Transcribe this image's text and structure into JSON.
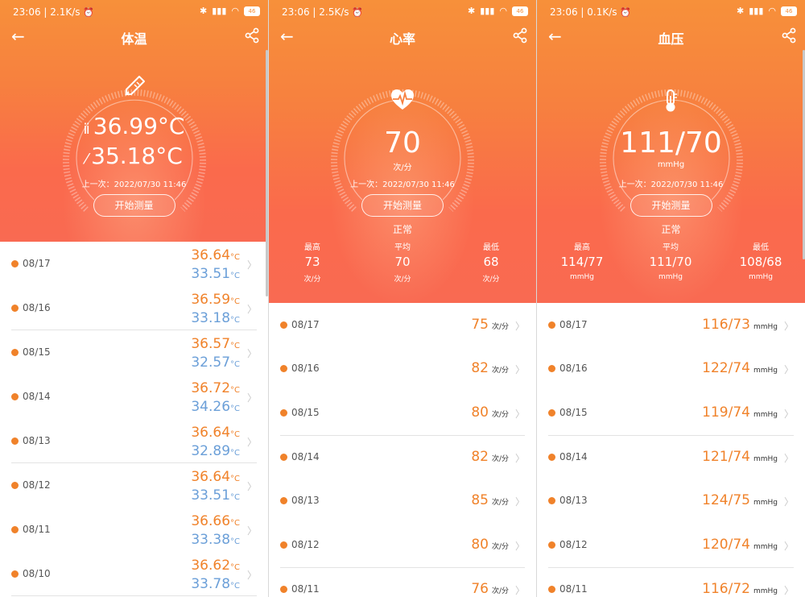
{
  "status_bars": [
    {
      "time": "23:06",
      "net": "2.1K/s",
      "battery": "46"
    },
    {
      "time": "23:06",
      "net": "2.5K/s",
      "battery": "46"
    },
    {
      "time": "23:06",
      "net": "0.1K/s",
      "battery": "46"
    }
  ],
  "temperature": {
    "title": "体温",
    "reading1": "36.99°C",
    "reading2": "35.18°C",
    "last_time": "上一次：2022/07/30 11:46",
    "measure_button": "开始测量",
    "unit": "°C",
    "rows": [
      {
        "date": "08/17",
        "v1": "36.64",
        "v2": "33.51"
      },
      {
        "date": "08/16",
        "v1": "36.59",
        "v2": "33.18"
      },
      {
        "date": "08/15",
        "v1": "36.57",
        "v2": "32.57"
      },
      {
        "date": "08/14",
        "v1": "36.72",
        "v2": "34.26"
      },
      {
        "date": "08/13",
        "v1": "36.64",
        "v2": "32.89"
      },
      {
        "date": "08/12",
        "v1": "36.64",
        "v2": "33.51"
      },
      {
        "date": "08/11",
        "v1": "36.66",
        "v2": "33.38"
      },
      {
        "date": "08/10",
        "v1": "36.62",
        "v2": "33.78"
      }
    ]
  },
  "heart_rate": {
    "title": "心率",
    "value": "70",
    "unit": "次/分",
    "last_time": "上一次：2022/07/30 11:46",
    "measure_button": "开始测量",
    "status": "正常",
    "stats": [
      {
        "label": "最高",
        "value": "73",
        "unit": "次/分"
      },
      {
        "label": "平均",
        "value": "70",
        "unit": "次/分"
      },
      {
        "label": "最低",
        "value": "68",
        "unit": "次/分"
      }
    ],
    "rows": [
      {
        "date": "08/17",
        "value": "75"
      },
      {
        "date": "08/16",
        "value": "82"
      },
      {
        "date": "08/15",
        "value": "80"
      },
      {
        "date": "08/14",
        "value": "82"
      },
      {
        "date": "08/13",
        "value": "85"
      },
      {
        "date": "08/12",
        "value": "80"
      },
      {
        "date": "08/11",
        "value": "76"
      }
    ]
  },
  "blood_pressure": {
    "title": "血压",
    "value": "111/70",
    "unit": "mmHg",
    "last_time": "上一次：2022/07/30 11:46",
    "measure_button": "开始测量",
    "status": "正常",
    "stats": [
      {
        "label": "最高",
        "value": "114/77",
        "unit": "mmHg"
      },
      {
        "label": "平均",
        "value": "111/70",
        "unit": "mmHg"
      },
      {
        "label": "最低",
        "value": "108/68",
        "unit": "mmHg"
      }
    ],
    "rows": [
      {
        "date": "08/17",
        "value": "116/73"
      },
      {
        "date": "08/16",
        "value": "122/74"
      },
      {
        "date": "08/15",
        "value": "119/74"
      },
      {
        "date": "08/14",
        "value": "121/74"
      },
      {
        "date": "08/13",
        "value": "124/75"
      },
      {
        "date": "08/12",
        "value": "120/74"
      },
      {
        "date": "08/11",
        "value": "116/72"
      }
    ]
  },
  "colors": {
    "accent": "#f0822a",
    "secondary": "#6b9fd8",
    "hero_top": "#f7903a",
    "hero_bottom": "#f96a52"
  },
  "icons": [
    "back-arrow-icon",
    "share-icon",
    "thermometer-icon",
    "heart-pulse-icon",
    "thermometer-bulb-icon",
    "chevron-right-icon"
  ]
}
